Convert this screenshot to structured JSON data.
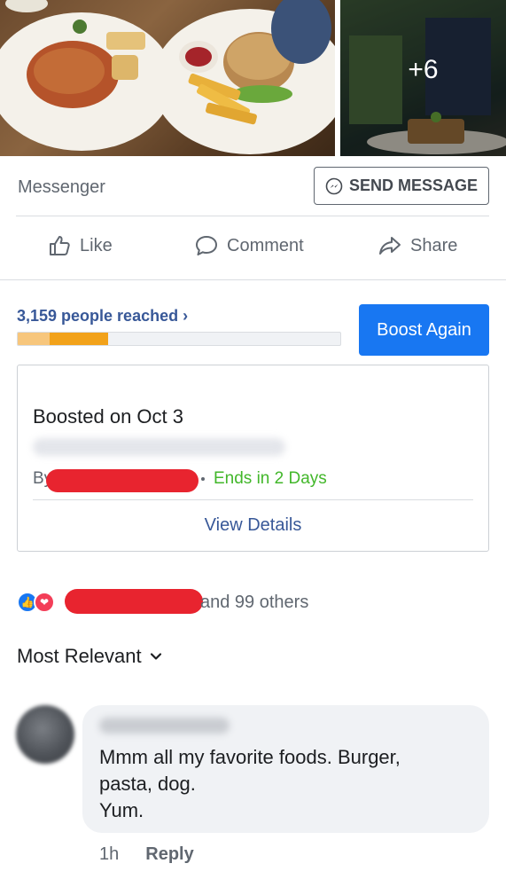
{
  "photos": {
    "more_count": "+6"
  },
  "messenger": {
    "label": "Messenger",
    "send_button": "SEND MESSAGE"
  },
  "actions": {
    "like": "Like",
    "comment": "Comment",
    "share": "Share"
  },
  "boost": {
    "reached": "3,159 people reached ›",
    "progress": {
      "segment_light_pct": 10,
      "segment_dark_pct": 18
    },
    "boost_again": "Boost Again",
    "card": {
      "title": "Boosted on Oct 3",
      "by_prefix": "By",
      "ends": "Ends in 2 Days",
      "view_details": "View Details"
    }
  },
  "reactions": {
    "others": "and 99 others"
  },
  "sort": {
    "label": "Most Relevant"
  },
  "comment": {
    "text": "Mmm all my favorite foods. Burger,\npasta, dog.\nYum.",
    "time": "1h",
    "reply": "Reply"
  },
  "colors": {
    "accent": "#1877f2",
    "link": "#385898",
    "green": "#42b72a",
    "redaction": "#e8242f"
  }
}
